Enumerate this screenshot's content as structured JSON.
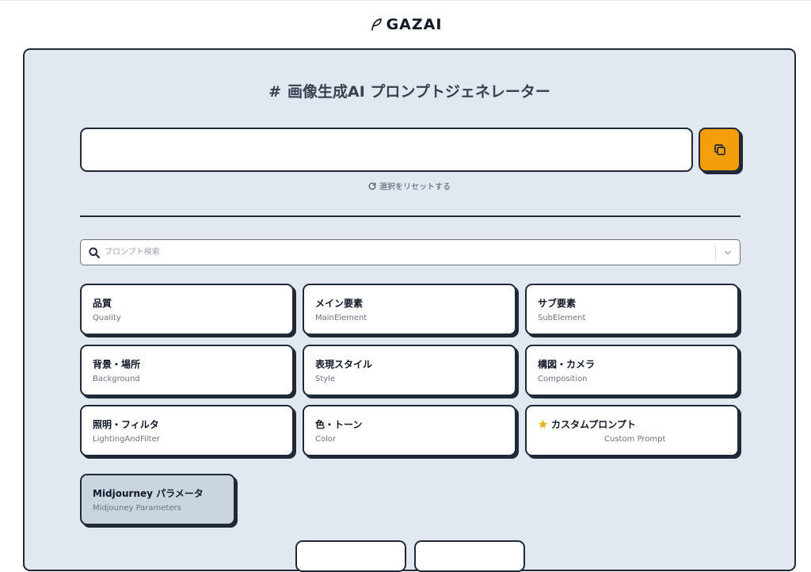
{
  "brand": {
    "name": "GAZAI",
    "icon": "feather-icon"
  },
  "generator": {
    "title": "画像生成AI プロンプトジェネレーター",
    "title_icon": "#",
    "prompt_value": "",
    "reset_label": "選択をリセットする",
    "search_placeholder": "プロンプト検索"
  },
  "categories": [
    {
      "jp": "品質",
      "en": "Quality"
    },
    {
      "jp": "メイン要素",
      "en": "MainElement"
    },
    {
      "jp": "サブ要素",
      "en": "SubElement"
    },
    {
      "jp": "背景・場所",
      "en": "Background"
    },
    {
      "jp": "表現スタイル",
      "en": "Style"
    },
    {
      "jp": "構図・カメラ",
      "en": "Composition"
    },
    {
      "jp": "照明・フィルタ",
      "en": "LightingAndFilter"
    },
    {
      "jp": "色・トーン",
      "en": "Color"
    },
    {
      "jp": "カスタムプロンプト",
      "en": "Custom Prompt",
      "icon": "star-icon"
    },
    {
      "jp": "Midjourney パラメータ",
      "en": "Midjouney Parameters"
    }
  ],
  "colors": {
    "accent": "#f59e0b",
    "panel": "#e2e8f0",
    "border": "#1f2937",
    "star": "#eab308"
  }
}
